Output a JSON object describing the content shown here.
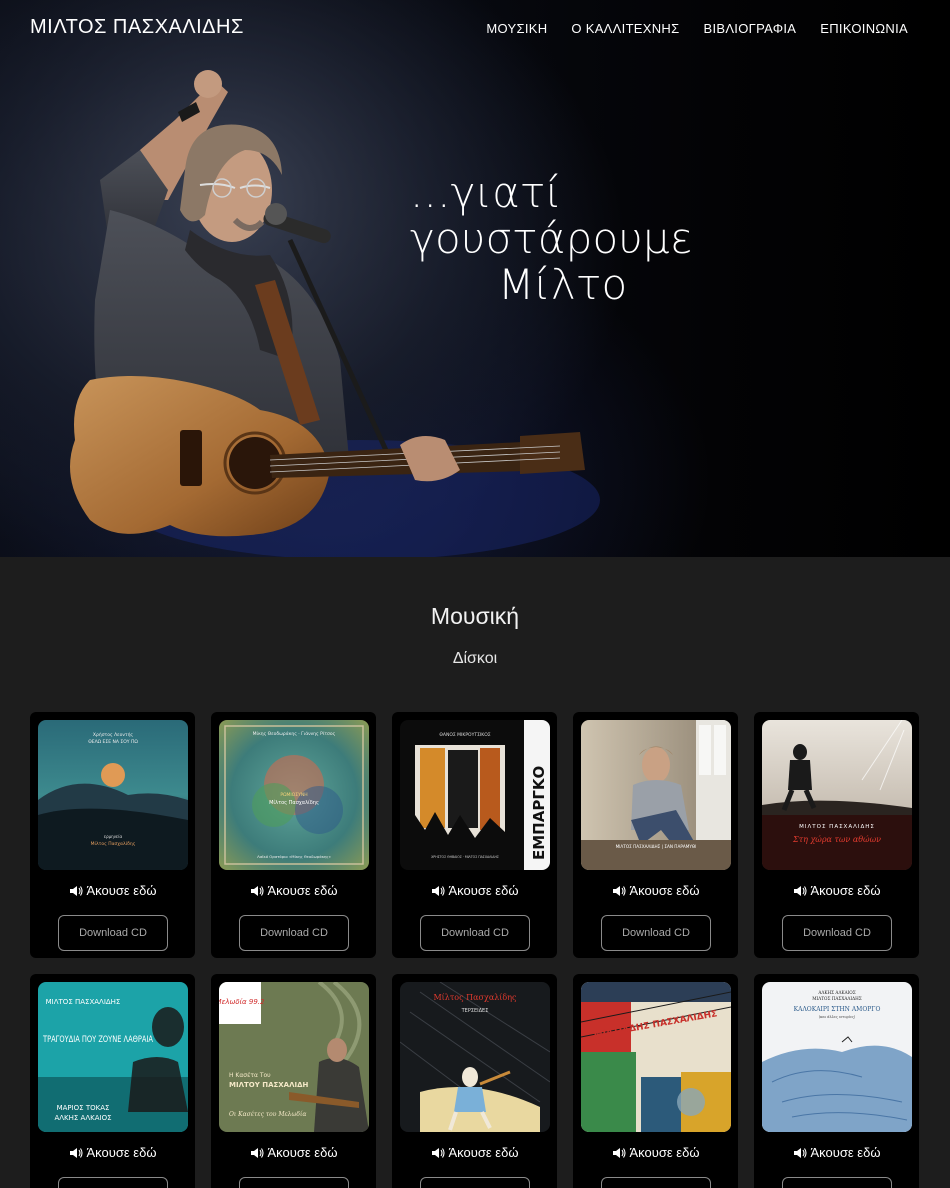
{
  "header": {
    "brand": "ΜΙΛΤΟΣ ΠΑΣΧΑΛΙΔΗΣ",
    "nav": [
      "ΜΟΥΣΙΚΗ",
      "Ο ΚΑΛΛΙΤΕΧΝΗΣ",
      "ΒΙΒΛΙΟΓΡΑΦΙΑ",
      "ΕΠΙΚΟΙΝΩΝΙΑ"
    ]
  },
  "hero": {
    "tagline_line1": "...γιατί γουστάρουμε",
    "tagline_line2": "Μίλτο"
  },
  "music": {
    "title": "Μουσική",
    "subtitle": "Δίσκοι",
    "listen_label": "Άκουσε εδώ",
    "download_label": "Download CD",
    "albums": [
      {
        "cover_text": [
          "Χρήστος Λεοντής",
          "ΘΕΛΩ ΕΣΕ ΝΑ ΣΟΥ ΠΩ",
          "ερμηνεία",
          "Μίλτος Πασχαλίδης"
        ]
      },
      {
        "cover_text": [
          "Μίκης Θεοδωράκης · Γιάννης Ρίτσος",
          "ΡΩΜΙΟΣΥΝΗ",
          "Μίλτος Πασχαλίδης",
          "Λαϊκό Ορατόριο «Μίκης Θεοδωράκης»"
        ]
      },
      {
        "cover_text": [
          "ΘΑΝΟΣ ΜΙΚΡΟΥΤΣΙΚΟΣ",
          "ΕΜΠΑΡΓΚΟ",
          "ΧΡΗΣΤΟΣ ΘΗΒΑΙΟΣ · ΜΙΛΤΟΣ ΠΑΣΧΑΛΙΔΗΣ"
        ]
      },
      {
        "cover_text": [
          "ΜΙΛΤΟΣ ΠΑΣΧΑΛΙΔΗΣ | ΣΑΝ ΠΑΡΑΜΥΘΙ"
        ]
      },
      {
        "cover_text": [
          "ΜΙΛΤΟΣ ΠΑΣΧΑΛΙΔΗΣ",
          "Στη χώρα των αθώων"
        ]
      },
      {
        "cover_text": [
          "ΜΙΛΤΟΣ ΠΑΣΧΑΛΙΔΗΣ",
          "ΤΡΑΓΟΥΔΙΑ ΠΟΥ ΖΟΥΝΕ ΛΑΘΡΑΙΑ",
          "ΜΑΡΙΟΣ ΤΟΚΑΣ",
          "ΑΛΚΗΣ ΑΛΚΑΙΟΣ"
        ]
      },
      {
        "cover_text": [
          "Μελωδία 99.2",
          "Η Κασέτα Του",
          "ΜΙΛΤΟΥ ΠΑΣΧΑΛΙΔΗ",
          "Οι Κασέτες του Μελωδία"
        ]
      },
      {
        "cover_text": [
          "Μίλτος Πασχαλίδης",
          "ΤΕΡΣΕΙΔΕΣ"
        ]
      },
      {
        "cover_text": [
          "ΜΙΛΤΙΑΔΗΣ ΠΑΣΧΑΛΙΔΗΣ"
        ]
      },
      {
        "cover_text": [
          "ΑΛΚΗΣ ΑΛΚΑΙΟΣ",
          "ΜΙΛΤΟΣ ΠΑΣΧΑΛΙΔΗΣ",
          "ΚΑΛΟΚΑΙΡΙ ΣΤΗΝ ΑΜΟΡΓΟ",
          "(και άλλες ιστορίες)"
        ]
      }
    ]
  },
  "icons": {
    "listen": "speaker-icon",
    "hero_figure": "performer-with-guitar"
  },
  "colors": {
    "background": "#1d1d1d",
    "card": "#000000",
    "text": "#ffffff",
    "button_border": "#8a8a8a"
  }
}
